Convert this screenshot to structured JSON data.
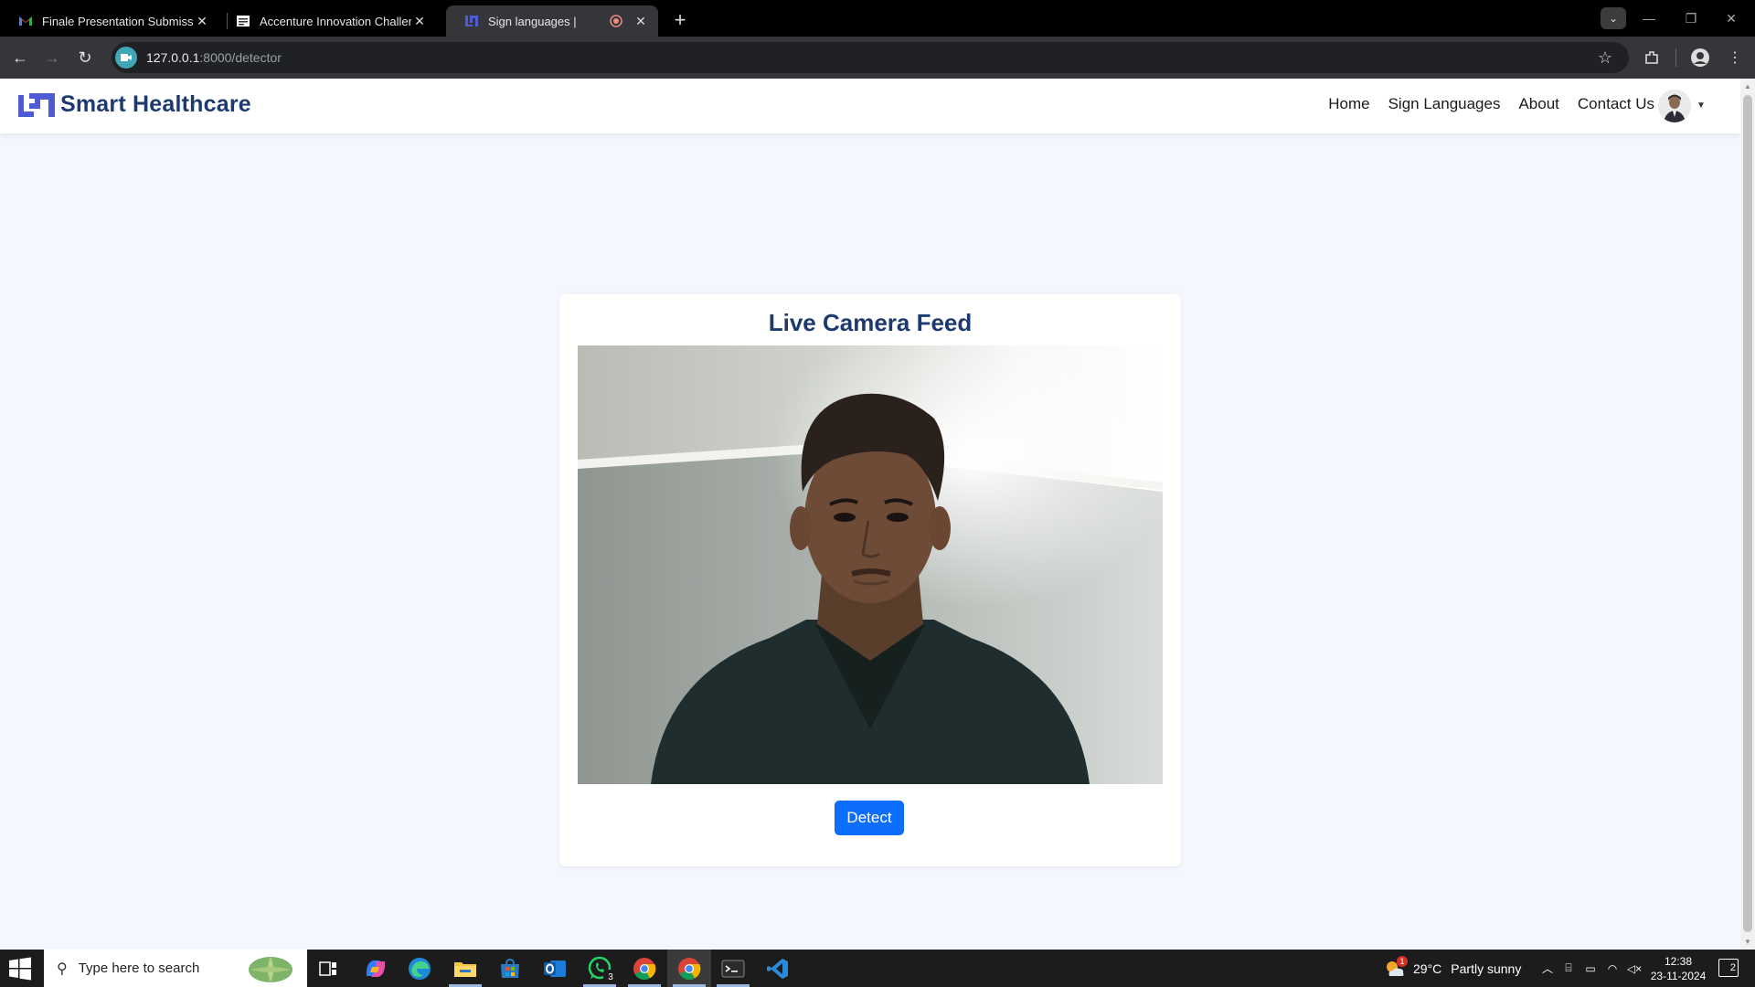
{
  "browser": {
    "tabs": [
      {
        "title": "Finale Presentation Submission",
        "icon": "gmail-icon"
      },
      {
        "title": "Accenture Innovation Challenge",
        "icon": "forms-icon"
      },
      {
        "title": "Sign languages |",
        "icon": "site-logo-icon",
        "recording": true
      }
    ],
    "url_host": "127.0.0.1",
    "url_path": ":8000/detector"
  },
  "navbar": {
    "brand": "Smart Healthcare",
    "links": [
      "Home",
      "Sign Languages",
      "About",
      "Contact Us"
    ]
  },
  "main": {
    "card_title": "Live Camera Feed",
    "detect_label": "Detect"
  },
  "taskbar": {
    "search_placeholder": "Type here to search",
    "weather_temp": "29°C",
    "weather_text": "Partly sunny",
    "time": "12:38",
    "date": "23-11-2024",
    "whatsapp_badge": "3",
    "notification_count": "2",
    "weather_badge": "1"
  },
  "colors": {
    "brand": "#1d3a70",
    "logo": "#4f5bd5",
    "button": "#0d6efd",
    "page_bg": "#f4f7fe"
  }
}
